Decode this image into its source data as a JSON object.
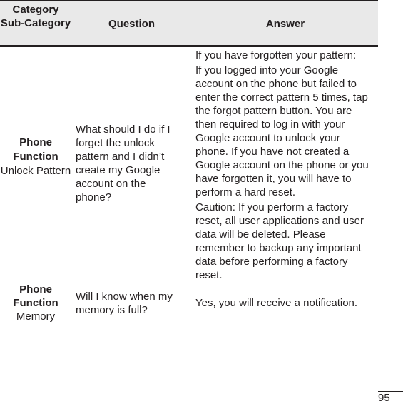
{
  "header": {
    "category_label": "Category",
    "subcategory_label": "Sub-Category",
    "question_label": "Question",
    "answer_label": "Answer"
  },
  "rows": [
    {
      "category": "Phone Function",
      "subcategory": "Unlock Pattern",
      "question": "What should I do if I forget the unlock pattern and I didn’t create my Google account on the phone?",
      "answer": [
        "If you have forgotten your pattern:",
        "If you logged into your Google account on the phone but failed to enter the correct pattern 5 times, tap the forgot pattern button. You are then required to log in with your Google account to unlock your phone. If you have not created a Google account on the phone or you have forgotten it, you will have to perform a hard reset.",
        "Caution: If you perform a factory reset, all user applications and user data will be deleted. Please remember to backup any important data before performing a factory reset."
      ]
    },
    {
      "category": "Phone Function",
      "subcategory": "Memory",
      "question": "Will I know when my memory is full?",
      "answer": [
        "Yes, you will receive a notification."
      ]
    }
  ],
  "page_number": "95"
}
